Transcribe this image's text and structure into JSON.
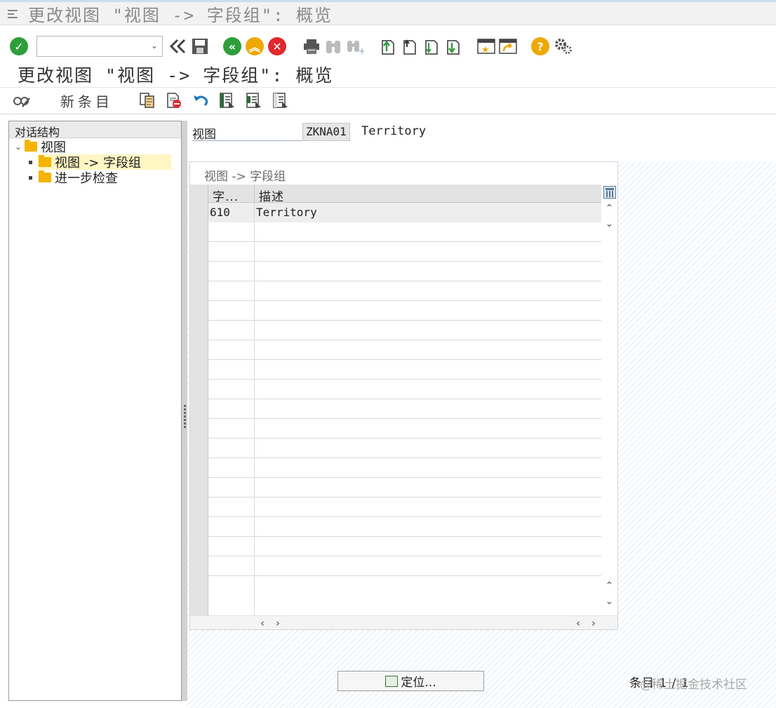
{
  "window": {
    "title": "更改视图 \"视图 -> 字段组\": 概览"
  },
  "toolbar": {
    "command_field_value": "",
    "icons": [
      "enter-icon",
      "command-field-dropdown-icon",
      "collapse-command-field-icon",
      "save-icon",
      "back-icon",
      "exit-icon",
      "cancel-icon",
      "print-icon",
      "find-icon",
      "find-next-icon",
      "first-page-icon",
      "previous-page-icon",
      "next-page-icon",
      "last-page-icon",
      "create-session-icon",
      "generate-shortcut-icon",
      "help-icon",
      "customize-layout-icon"
    ],
    "colors": {
      "enter": "#2e9e3b",
      "back": "#2e9e3b",
      "exit": "#f0a800",
      "cancel": "#e0282f",
      "help": "#f0a800"
    }
  },
  "screen": {
    "title": "更改视图 \"视图 -> 字段组\": 概览"
  },
  "app_toolbar": {
    "new_entries_label": "新条目",
    "icons": [
      "display-change-icon",
      "copy-as-icon",
      "delete-icon",
      "undo-change-icon",
      "select-all-icon",
      "select-block-icon",
      "deselect-all-icon"
    ]
  },
  "dialog_structure": {
    "header": "对话结构",
    "root": "视图",
    "items": [
      {
        "label": "视图 -> 字段组",
        "selected": true
      },
      {
        "label": "进一步检查",
        "selected": false
      }
    ]
  },
  "view_field": {
    "label": "视图",
    "value": "ZKNA01",
    "description": "Territory"
  },
  "table": {
    "caption": "视图 -> 字段组",
    "columns": [
      "字...",
      "描述"
    ],
    "rows": [
      {
        "field_group": "610",
        "description": "Territory"
      }
    ]
  },
  "bottom": {
    "position_button": "定位...",
    "entry_counter": "条目 1 / 1",
    "watermark": "@稀土掘金技术社区"
  }
}
